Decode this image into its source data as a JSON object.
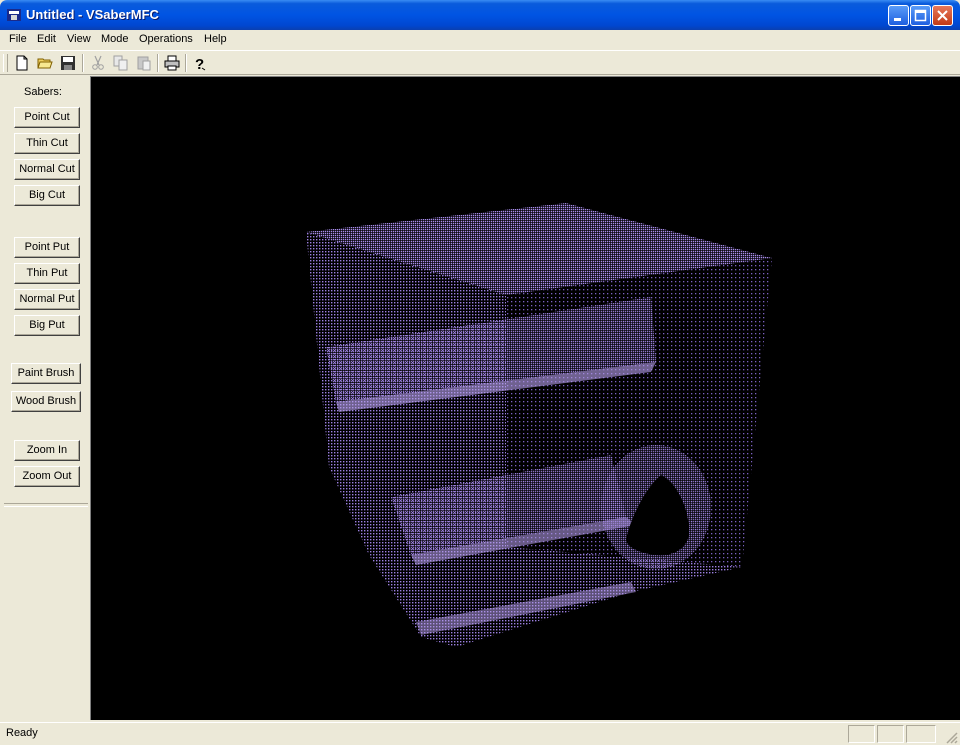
{
  "window": {
    "title": "Untitled - VSaberMFC"
  },
  "menu": [
    "File",
    "Edit",
    "View",
    "Mode",
    "Operations",
    "Help"
  ],
  "toolbar": {
    "tools": [
      "new-file-icon",
      "open-folder-icon",
      "save-icon",
      "cut-icon",
      "copy-icon",
      "paste-icon",
      "print-icon",
      "help-icon"
    ]
  },
  "sidebar": {
    "heading": "Sabers:",
    "cut_buttons": [
      "Point Cut",
      "Thin Cut",
      "Normal Cut",
      "Big Cut"
    ],
    "put_buttons": [
      "Point Put",
      "Thin Put",
      "Normal Put",
      "Big Put"
    ],
    "brush_buttons": [
      "Paint Brush",
      "Wood Brush"
    ],
    "zoom_buttons": [
      "Zoom In",
      "Zoom Out"
    ]
  },
  "viewport": {
    "background": "#000000",
    "mesh_color": "#9b7fe0"
  },
  "status": {
    "text": "Ready"
  }
}
